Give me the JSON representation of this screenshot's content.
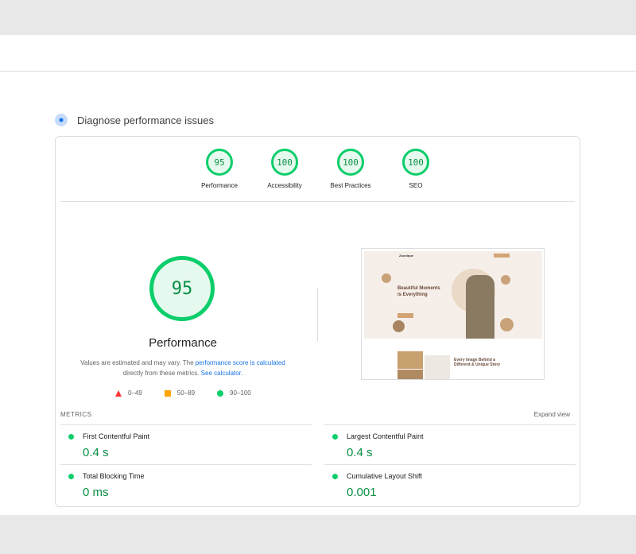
{
  "section_title": "Diagnose performance issues",
  "categories": [
    {
      "label": "Performance",
      "score": "95"
    },
    {
      "label": "Accessibility",
      "score": "100"
    },
    {
      "label": "Best Practices",
      "score": "100"
    },
    {
      "label": "SEO",
      "score": "100"
    }
  ],
  "main_score": "95",
  "main_title": "Performance",
  "note": {
    "t1": "Values are estimated and may vary. The ",
    "link1": "performance score is calculated",
    "t2": " directly from these metrics. ",
    "link2": "See calculator."
  },
  "legend": [
    "0–49",
    "50–89",
    "90–100"
  ],
  "thumbnail": {
    "brand": "Zoonique",
    "hero": "Beautiful Moments is Everything",
    "section": "Every Image Behind a Different & Unique Story"
  },
  "metrics_label": "METRICS",
  "expand_label": "Expand view",
  "metrics": [
    {
      "name": "First Contentful Paint",
      "value": "0.4 s"
    },
    {
      "name": "Largest Contentful Paint",
      "value": "0.4 s"
    },
    {
      "name": "Total Blocking Time",
      "value": "0 ms"
    },
    {
      "name": "Cumulative Layout Shift",
      "value": "0.001"
    }
  ]
}
